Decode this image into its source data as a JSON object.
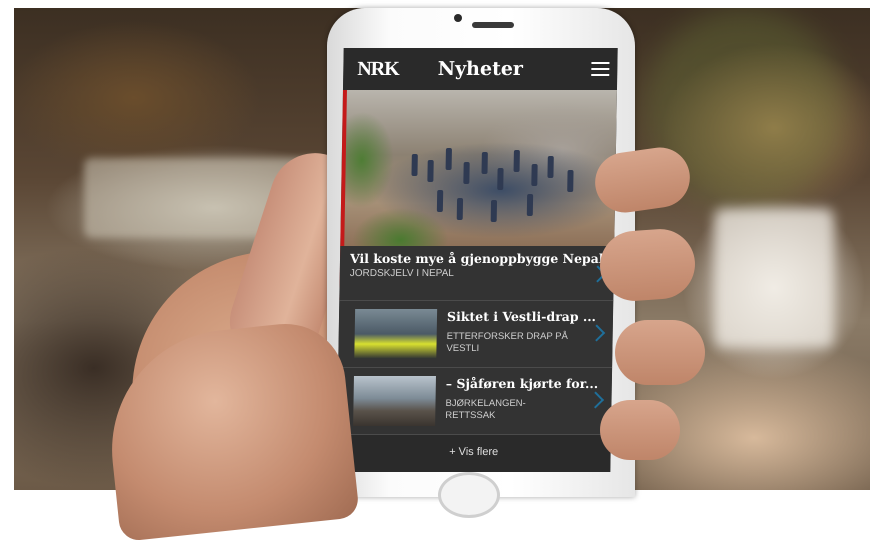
{
  "app": {
    "logo": "NRK",
    "title": "Nyheter"
  },
  "hero": {
    "title": "Vil koste mye å gjenoppbygge Nepal",
    "subtitle": "JORDSKJELV I NEPAL"
  },
  "stories": [
    {
      "title": "Siktet i Vestli-drap ...",
      "subtitle": "ETTERFORSKER DRAP PÅ VESTLI"
    },
    {
      "title": "– Sjåføren kjørte for...",
      "subtitle": "BJØRKELANGEN-RETTSSAK"
    }
  ],
  "more": {
    "label": "+ Vis flere"
  },
  "colors": {
    "accent": "#c41a1a",
    "chevron": "#1f6f9a",
    "screen_bg": "#333333",
    "header_bg": "#2a2a2a"
  },
  "icons": [
    "menu-icon",
    "chevron-right-icon"
  ]
}
